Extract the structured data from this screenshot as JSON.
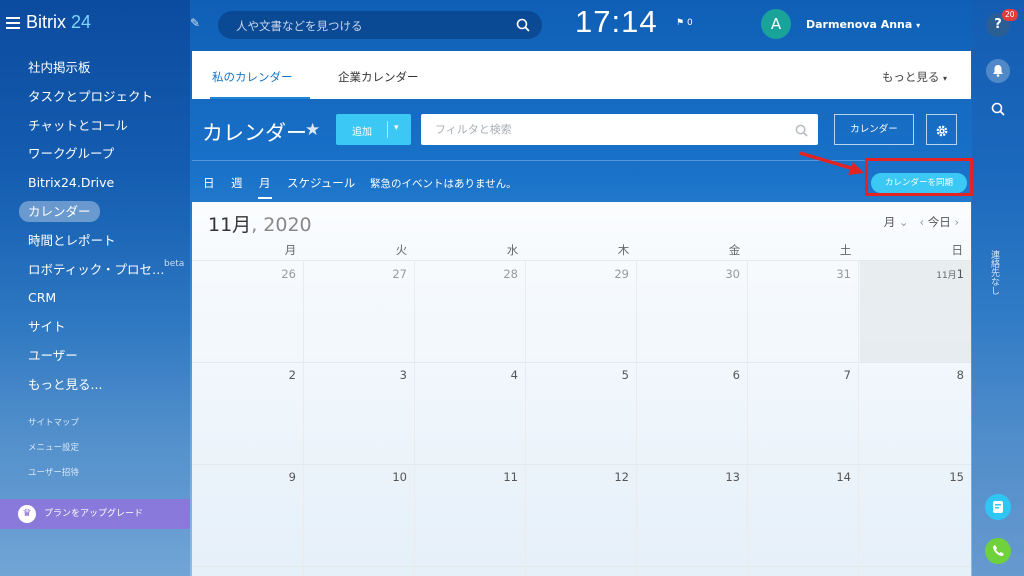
{
  "app": {
    "logo_text": "Bitrix",
    "logo_num": "24"
  },
  "sidebar": {
    "items": [
      {
        "label": "社内掲示板"
      },
      {
        "label": "タスクとプロジェクト"
      },
      {
        "label": "チャットとコール"
      },
      {
        "label": "ワークグループ"
      },
      {
        "label": "Bitrix24.Drive"
      },
      {
        "label": "カレンダー",
        "active": true
      },
      {
        "label": "時間とレポート"
      },
      {
        "label": "ロボティック・プロセ…",
        "badge": "beta"
      },
      {
        "label": "CRM"
      },
      {
        "label": "サイト"
      },
      {
        "label": "ユーザー"
      },
      {
        "label": "もっと見る..."
      }
    ],
    "small_links": [
      "サイトマップ",
      "メニュー設定",
      "ユーザー招待"
    ],
    "upgrade_label": "プランをアップグレード"
  },
  "topbar": {
    "search_placeholder": "人や文書などを見つける",
    "clock": "17:14",
    "flag_count": "0",
    "avatar_letter": "A",
    "user_name": "Darmenova Anna"
  },
  "rightbar": {
    "help_badge": "20",
    "vertical_text": "連絡先なし"
  },
  "tabs": {
    "items": [
      "私のカレンダー",
      "企業カレンダー"
    ],
    "more": "もっと見る"
  },
  "toolbar": {
    "title": "カレンダー",
    "add_label": "追加",
    "filter_placeholder": "フィルタと検索",
    "calendar_button": "カレンダー"
  },
  "views": {
    "items": [
      "日",
      "週",
      "月",
      "スケジュール"
    ],
    "active": "月",
    "notice": "緊急のイベントはありません。",
    "sync_button": "カレンダーを同期"
  },
  "calendar": {
    "month": "11月",
    "year": "2020",
    "view_select": "月",
    "today": "今日",
    "day_headers": [
      "月",
      "火",
      "水",
      "木",
      "金",
      "土",
      "日"
    ],
    "weeks": [
      [
        "26",
        "27",
        "28",
        "29",
        "30",
        "31",
        "1"
      ],
      [
        "2",
        "3",
        "4",
        "5",
        "6",
        "7",
        "8"
      ],
      [
        "9",
        "10",
        "11",
        "12",
        "13",
        "14",
        "15"
      ]
    ],
    "first_of_month_prefix": "11月"
  },
  "colors": {
    "accent": "#3bc8f5",
    "highlight": "#e52222",
    "tab_active": "#1575c5"
  }
}
